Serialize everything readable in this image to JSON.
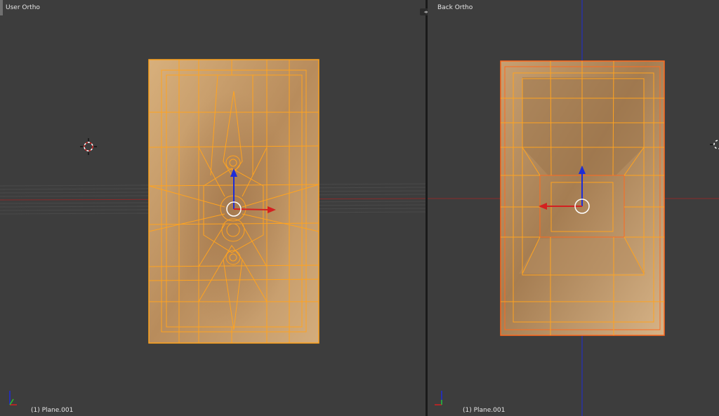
{
  "viewports": {
    "left": {
      "title": "User Ortho",
      "object_label": "(1) Plane.001"
    },
    "right": {
      "title": "Back Ortho",
      "object_label": "(1) Plane.001"
    }
  },
  "colors": {
    "background": "#3d3d3d",
    "mesh_fill": "#c9a06c",
    "wire": "#ffa31f",
    "axis_red": "#d42020",
    "axis_blue": "#1e2dd6"
  },
  "icons": [
    "3d-cursor-icon",
    "axis-gizmo-icon",
    "split-area-icon",
    "manipulator-icon"
  ]
}
